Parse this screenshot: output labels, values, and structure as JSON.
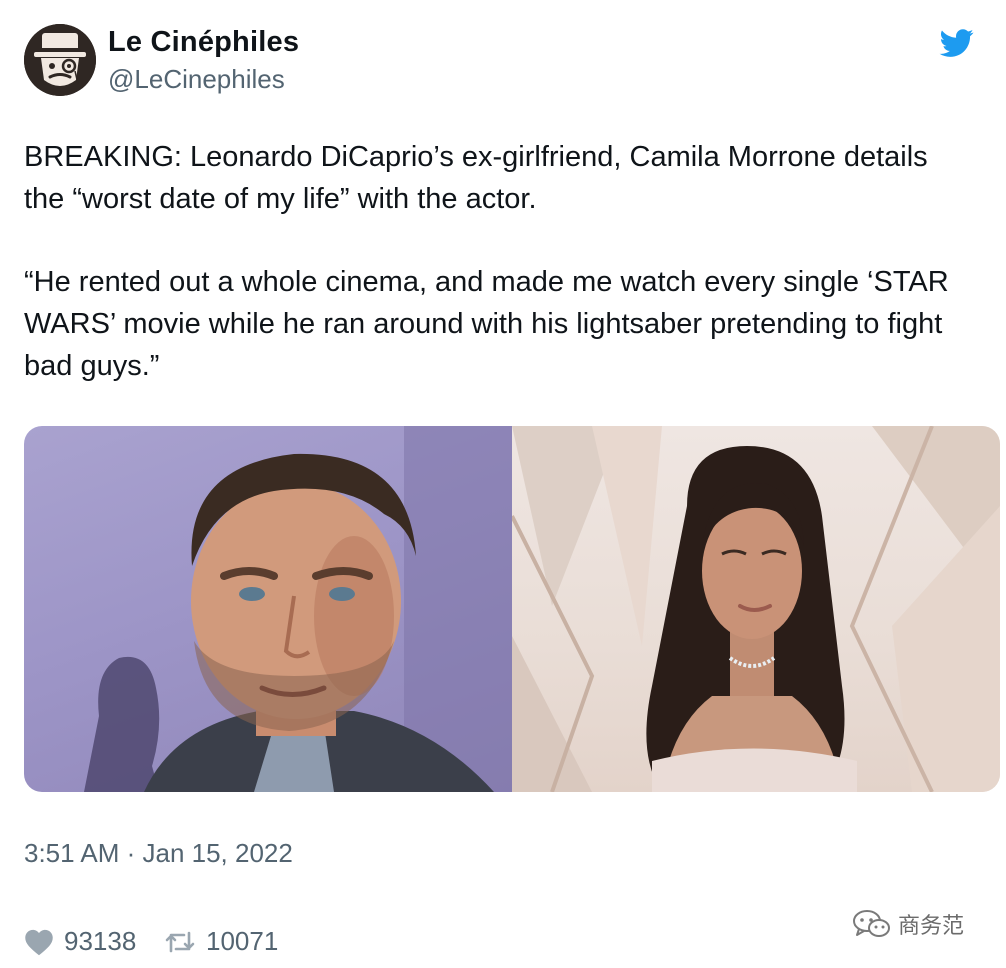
{
  "author": {
    "display_name": "Le Cinéphiles",
    "handle": "@LeCinephiles"
  },
  "tweet": {
    "paragraphs": [
      "BREAKING: Leonardo DiCaprio’s ex-girlfriend, Camila Morrone details the “worst date of my life” with the actor.",
      "“He rented out a whole cinema, and made me watch every single ‘STAR WARS’ movie while he ran around with his lightsaber pretending to fight bad guys.”"
    ],
    "timestamp": "3:51 AM · Jan 15, 2022"
  },
  "stats": {
    "likes": "93138",
    "retweets": "10071"
  },
  "watermark": {
    "text": "商务范"
  },
  "icons": {
    "brand": "twitter-bird-icon",
    "like": "heart-icon",
    "retweet": "retweet-icon",
    "watermark": "wechat-icon"
  },
  "colors": {
    "twitter_blue": "#1d9bf0",
    "text_primary": "#0f1419",
    "text_secondary": "#536471"
  }
}
